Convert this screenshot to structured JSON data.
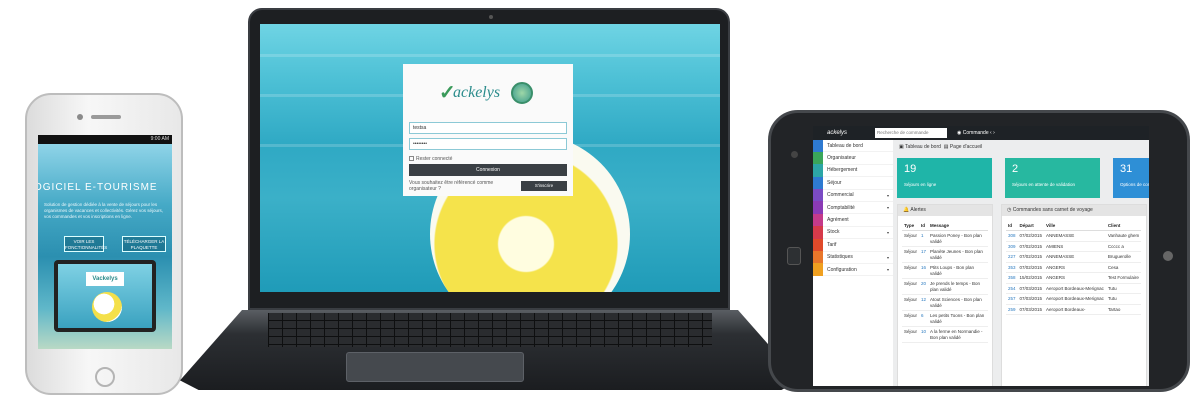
{
  "phone": {
    "status_time": "9:00 AM",
    "hero_title": "OGICIEL E-TOURISME",
    "hero_text": "Solution de gestion dédiée à la vente de séjours pour les organismes de vacances et collectivités. Gérez vos séjours, vos commandes et vos inscriptions en ligne.",
    "btn_features": "VOIR LES FONCTIONNALITÉS",
    "btn_download": "TÉLÉCHARGER LA PLAQUETTE",
    "mini_logo": "Vackelys"
  },
  "laptop": {
    "login": {
      "logo_text": "ackelys",
      "username_value": "testsa",
      "password_value": "••••••••",
      "remember_label": "Rester connecté",
      "submit_label": "Connexion",
      "referral_text": "Vous souhaitez être référencé comme organisateur ?",
      "register_label": "S'inscrire"
    }
  },
  "tablet": {
    "brand": "ackelys",
    "search_placeholder": "Recherche de commande",
    "command_label": "Commande",
    "breadcrumb": {
      "dashboard": "Tableau de bord",
      "home": "Page d'accueil"
    },
    "sidebar": [
      {
        "label": "Tableau de bord",
        "color": "#2e7ad1",
        "caret": ""
      },
      {
        "label": "Organisateur",
        "color": "#3aa65a",
        "caret": ""
      },
      {
        "label": "Hébergement",
        "color": "#2ca6a6",
        "caret": ""
      },
      {
        "label": "Séjour",
        "color": "#2e7ad1",
        "caret": ""
      },
      {
        "label": "Commercial",
        "color": "#7a4bc4",
        "caret": "▾"
      },
      {
        "label": "Comptabilité",
        "color": "#8a3ab5",
        "caret": "▾"
      },
      {
        "label": "Agrément",
        "color": "#c43a8a",
        "caret": ""
      },
      {
        "label": "Stock",
        "color": "#d63a4a",
        "caret": "▾"
      },
      {
        "label": "Tarif",
        "color": "#e04a2a",
        "caret": ""
      },
      {
        "label": "Statistiques",
        "color": "#e8762a",
        "caret": "▾"
      },
      {
        "label": "Configuration",
        "color": "#f0a020",
        "caret": "▾"
      }
    ],
    "cards": [
      {
        "number": "19",
        "label": "Séjours en ligne",
        "color": "#1fb5a8"
      },
      {
        "number": "2",
        "label": "Séjours en attente de validation",
        "color": "#27b8a0"
      },
      {
        "number": "31",
        "label": "Options de commande",
        "color": "#2e8fd6"
      }
    ],
    "alerts": {
      "title": "Alertes",
      "headers": [
        "Type",
        "Id",
        "Message"
      ],
      "rows": [
        [
          "Séjour",
          "1",
          "Passion Poney - Bon plan validé"
        ],
        [
          "Séjour",
          "17",
          "Planète Jeunes - Bon plan validé"
        ],
        [
          "Séjour",
          "16",
          "Ptits Loups - Bon plan validé"
        ],
        [
          "Séjour",
          "20",
          "Je prends le temps - Bon plan validé"
        ],
        [
          "Séjour",
          "12",
          "Atout Sciences - Bon plan validé"
        ],
        [
          "Séjour",
          "6",
          "Les petits Toons - Bon plan validé"
        ],
        [
          "Séjour",
          "10",
          "A la ferme en Normandie - Bon plan validé"
        ]
      ]
    },
    "orders": {
      "title": "Commandes sans carnet de voyage",
      "headers": [
        "Id",
        "Départ",
        "Ville",
        "Client"
      ],
      "rows": [
        [
          "308",
          "07/02/2015",
          "ANNEMASSE",
          "Vanhaute ghem"
        ],
        [
          "309",
          "07/02/2015",
          "AMIENS",
          "Ccccc a"
        ],
        [
          "227",
          "07/02/2015",
          "ANNEMASSE",
          "Bruguerolle"
        ],
        [
          "353",
          "07/02/2015",
          "ANGERS",
          "Cesa"
        ],
        [
          "358",
          "15/02/2015",
          "ANGERS",
          "Test Formulaire"
        ],
        [
          "254",
          "07/03/2015",
          "Aeroport Bordeaux-Merignac",
          "Tutu"
        ],
        [
          "257",
          "07/03/2015",
          "Aeroport Bordeaux-Merignac",
          "Tutu"
        ],
        [
          "259",
          "07/03/2015",
          "Aeroport Bordeaux-",
          "Tartao"
        ]
      ]
    }
  }
}
